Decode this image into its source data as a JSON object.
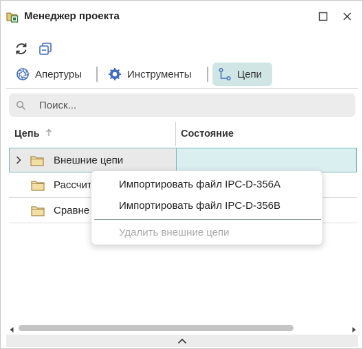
{
  "window": {
    "title": "Менеджер проекта"
  },
  "toolbar": {
    "refresh_icon": "refresh-icon",
    "collapse_icon": "collapse-all-icon"
  },
  "tabs": [
    {
      "label": "Апертуры",
      "icon": "aperture-icon",
      "active": false
    },
    {
      "label": "Инструменты",
      "icon": "tool-icon",
      "active": false
    },
    {
      "label": "Цепи",
      "icon": "net-icon",
      "active": true
    }
  ],
  "search": {
    "placeholder": "Поиск..."
  },
  "tree": {
    "columns": [
      "Цепь",
      "Состояние"
    ],
    "sort_column": "Цепь",
    "sort_direction": "ascending",
    "rows": [
      {
        "label": "Внешние цепи",
        "expandable": true,
        "selected": true
      },
      {
        "label": "Рассчит",
        "expandable": false,
        "selected": false
      },
      {
        "label": "Сравне",
        "expandable": false,
        "selected": false
      }
    ]
  },
  "context_menu": {
    "items": [
      {
        "label": "Импортировать файл IPC-D-356A",
        "enabled": true
      },
      {
        "label": "Импортировать файл IPC-D-356B",
        "enabled": true
      },
      {
        "label": "Удалить внешние цепи",
        "enabled": false
      }
    ]
  },
  "colors": {
    "active_tab_bg": "#cfe6e5",
    "selection_border": "#79b9bd",
    "selection_state_bg": "#d9eff0",
    "folder_fill": "#f3dfa2",
    "folder_stroke": "#a5874a"
  }
}
